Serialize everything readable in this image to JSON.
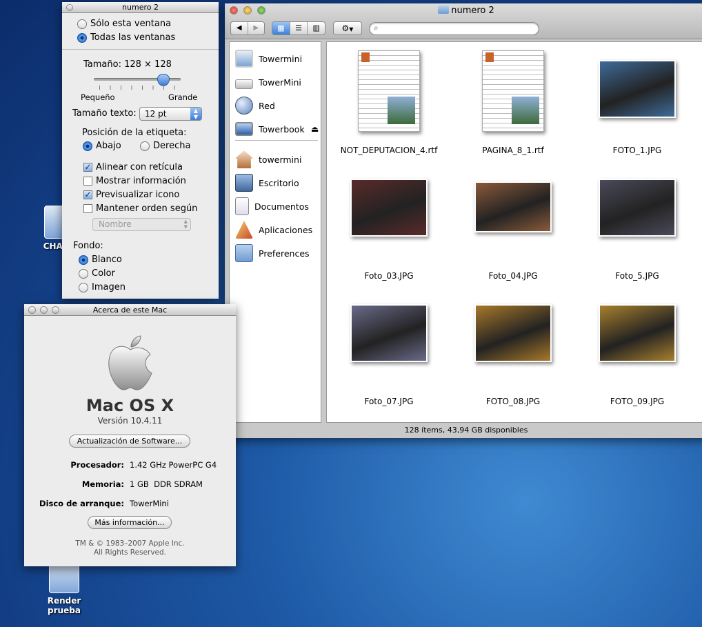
{
  "desktop": {
    "icon1_label": "CHAVO",
    "icon2_label": "Render prueba"
  },
  "inspector": {
    "title": "numero 2",
    "scope_this": "Sólo esta ventana",
    "scope_all": "Todas las ventanas",
    "size_label": "Tamaño: 128 × 128",
    "size_min": "Pequeño",
    "size_max": "Grande",
    "size_level": 0.85,
    "text_size_label": "Tamaño texto:",
    "text_size_value": "12 pt",
    "label_pos_title": "Posición de la etiqueta:",
    "label_pos_bottom": "Abajo",
    "label_pos_right": "Derecha",
    "snap_grid": "Alinear con retícula",
    "show_info": "Mostrar información",
    "preview_icon": "Previsualizar icono",
    "keep_sorted": "Mantener orden según",
    "sort_value": "Nombre",
    "background_title": "Fondo:",
    "bg_white": "Blanco",
    "bg_color": "Color",
    "bg_image": "Imagen"
  },
  "about": {
    "title": "Acerca de este Mac",
    "os_name": "Mac OS X",
    "version": "Versión 10.4.11",
    "update_button": "Actualización de Software...",
    "processor_label": "Procesador:",
    "processor_value": "1.42 GHz PowerPC G4",
    "memory_label": "Memoria:",
    "memory_value": "1 GB  DDR SDRAM",
    "disk_label": "Disco de arranque:",
    "disk_value": "TowerMini",
    "more_button": "Más información...",
    "copyright": "TM & © 1983–2007 Apple Inc.",
    "rights": "All Rights Reserved."
  },
  "finder": {
    "title": "numero 2",
    "status": "128 ítems, 43,94 GB disponibles",
    "sidebar": [
      {
        "label": "Towermini",
        "icon": "imac-icon"
      },
      {
        "label": "TowerMini",
        "icon": "mac-mini-icon"
      },
      {
        "label": "Red",
        "icon": "network-globe-icon"
      },
      {
        "label": "Towerbook",
        "icon": "powerbook-icon"
      },
      {
        "label": "towermini",
        "icon": "home-icon"
      },
      {
        "label": "Escritorio",
        "icon": "desktop-folder-icon"
      },
      {
        "label": "Documentos",
        "icon": "documents-icon"
      },
      {
        "label": "Aplicaciones",
        "icon": "applications-icon"
      },
      {
        "label": "Preferences",
        "icon": "folder-icon"
      }
    ],
    "files": [
      {
        "name": "NOT_DEPUTACION_4.rtf",
        "kind": "rtf"
      },
      {
        "name": "PAGINA_8_1.rtf",
        "kind": "rtf"
      },
      {
        "name": "FOTO_1.JPG",
        "kind": "photo",
        "color": "#3f6c9a"
      },
      {
        "name": "Foto_03.JPG",
        "kind": "photo",
        "color": "#5a2a2a"
      },
      {
        "name": "Foto_04.JPG",
        "kind": "photo",
        "color": "#8a5a3a"
      },
      {
        "name": "Foto_5.JPG",
        "kind": "photo",
        "color": "#4a4a5a"
      },
      {
        "name": "Foto_07.JPG",
        "kind": "photo",
        "color": "#6a6a8a"
      },
      {
        "name": "FOTO_08.JPG",
        "kind": "photo",
        "color": "#a8782a"
      },
      {
        "name": "FOTO_09.JPG",
        "kind": "photo",
        "color": "#a8802e"
      }
    ]
  }
}
